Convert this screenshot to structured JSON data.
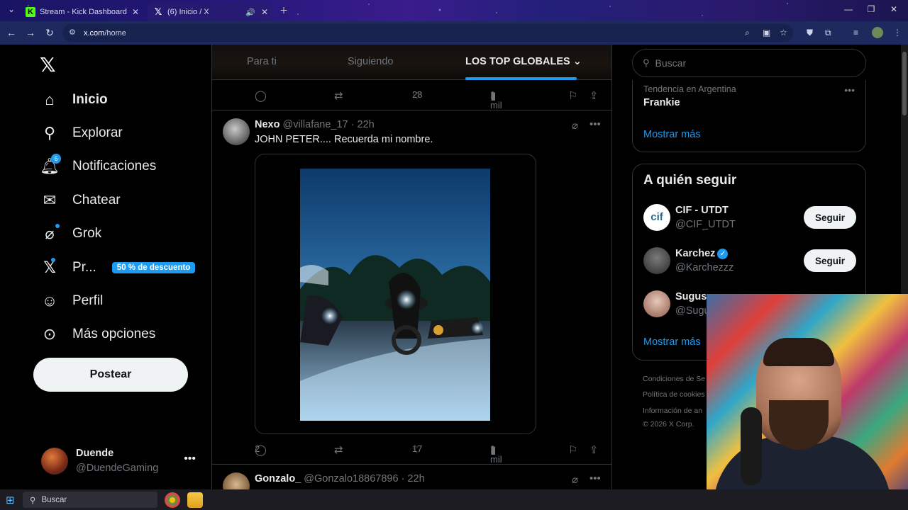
{
  "browser": {
    "tabs": [
      {
        "title": "Stream - Kick Dashboard",
        "favicon": "K"
      },
      {
        "title": "(6) Inicio / X",
        "favicon": "𝕏"
      }
    ],
    "url_host": "x.com",
    "url_path": "/home"
  },
  "nav": {
    "items": [
      {
        "label": "Inicio",
        "icon": "home-icon"
      },
      {
        "label": "Explorar",
        "icon": "search-icon"
      },
      {
        "label": "Notificaciones",
        "icon": "bell-icon",
        "badge": "6"
      },
      {
        "label": "Chatear",
        "icon": "mail-icon"
      },
      {
        "label": "Grok",
        "icon": "grok-icon"
      },
      {
        "label": "Pr...",
        "icon": "x-premium-icon",
        "promo": "50 % de descuento"
      },
      {
        "label": "Perfil",
        "icon": "person-icon"
      },
      {
        "label": "Más opciones",
        "icon": "more-circle-icon"
      }
    ],
    "post_label": "Postear",
    "profile": {
      "name": "Duende",
      "handle": "@DuendeGaming"
    }
  },
  "feed": {
    "tabs": {
      "for_you": "Para ti",
      "following": "Siguiendo",
      "top": "LOS TOP GLOBALES"
    },
    "prev_actions": {
      "likes": "28",
      "views": "1 mil"
    },
    "tweet": {
      "name": "Nexo",
      "handle": "@villafane_17",
      "time": "· 22h",
      "text": "JOHN PETER.... Recuerda mi nombre.",
      "replies": "2",
      "likes": "17",
      "views": "1 mil"
    },
    "next_tweet": {
      "name": "Gonzalo_",
      "handle": "@Gonzalo18867896",
      "time": "· 22h"
    }
  },
  "right": {
    "search_placeholder": "Buscar",
    "trend": {
      "meta": "Tendencia en Argentina",
      "name": "Frankie",
      "show_more": "Mostrar más"
    },
    "who_to_follow": {
      "title": "A quién seguir",
      "users": [
        {
          "name": "CIF - UTDT",
          "handle": "@CIF_UTDT",
          "button": "Seguir"
        },
        {
          "name": "Karchez",
          "handle": "@Karchezzz",
          "button": "Seguir",
          "verified": true
        },
        {
          "name": "Sugus",
          "handle": "@Sugu"
        }
      ],
      "show_more": "Mostrar más"
    },
    "footer": [
      "Condiciones de Se",
      "Política de cookies",
      "Información de an",
      "© 2026 X Corp."
    ]
  },
  "taskbar": {
    "search": "Buscar"
  },
  "colors": {
    "accent": "#1d9bf0",
    "background": "#000000",
    "muted": "#71767b"
  }
}
